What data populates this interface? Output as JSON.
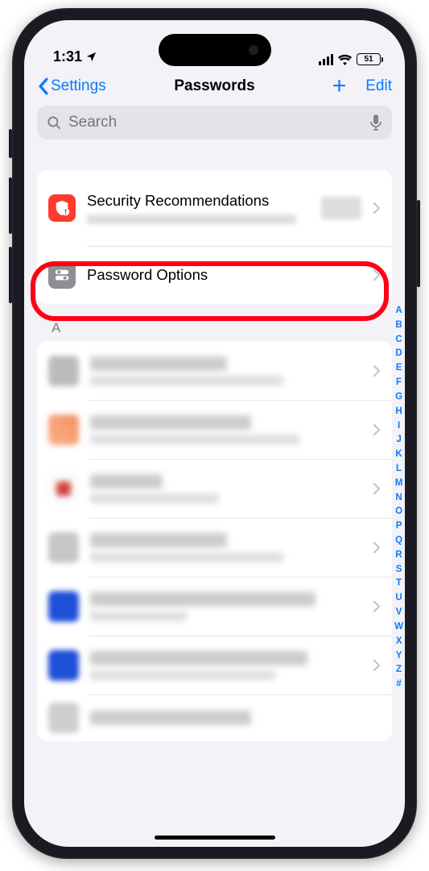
{
  "status": {
    "time": "1:31",
    "battery": "51"
  },
  "nav": {
    "back": "Settings",
    "title": "Passwords",
    "edit": "Edit"
  },
  "search": {
    "placeholder": "Search"
  },
  "top_rows": {
    "security": "Security Recommenda­tions",
    "options": "Password Options"
  },
  "section_letter": "A",
  "index": [
    "A",
    "B",
    "C",
    "D",
    "E",
    "F",
    "G",
    "H",
    "I",
    "J",
    "K",
    "L",
    "M",
    "N",
    "O",
    "P",
    "Q",
    "R",
    "S",
    "T",
    "U",
    "V",
    "W",
    "X",
    "Y",
    "Z",
    "#"
  ]
}
